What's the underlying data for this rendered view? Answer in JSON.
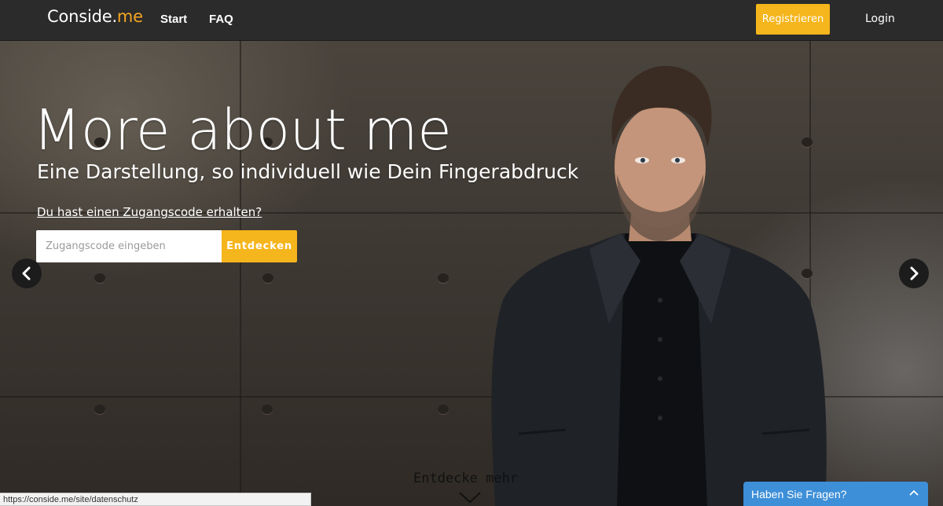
{
  "header": {
    "brand_main": "Conside.",
    "brand_accent": "me",
    "nav": {
      "start": "Start",
      "faq": "FAQ"
    },
    "register_label": "Registrieren",
    "login_label": "Login"
  },
  "hero": {
    "headline": "More about me",
    "subline": "Eine Darstellung, so individuell wie Dein Fingerabdruck",
    "code_link": "Du hast einen Zugangscode erhalten?",
    "code_input": {
      "placeholder": "Zugangscode eingeben",
      "value": ""
    },
    "discover_label": "Entdecken",
    "more_label": "Entdecke mehr"
  },
  "statusbar": {
    "url": "https://conside.me/site/datenschutz"
  },
  "chat": {
    "label": "Haben Sie Fragen?"
  },
  "colors": {
    "accent": "#f5b51c",
    "nav_bg": "#2b2b2b",
    "chat_bg": "#3d8fd8"
  },
  "icons": [
    "chevron-left-icon",
    "chevron-right-icon",
    "chevron-down-icon",
    "chevron-up-icon"
  ]
}
